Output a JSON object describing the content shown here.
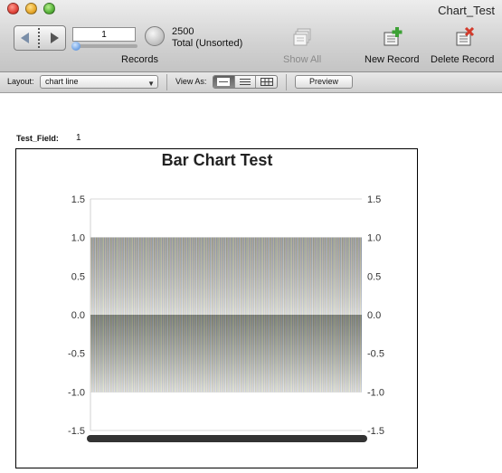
{
  "window": {
    "title": "Chart_Test"
  },
  "toolbar": {
    "record_input_value": "1",
    "record_count": "2500",
    "record_status": "Total (Unsorted)",
    "records_label": "Records",
    "show_all_label": "Show All",
    "new_record_label": "New Record",
    "delete_record_label": "Delete Record"
  },
  "layout_bar": {
    "layout_label": "Layout:",
    "layout_value": "chart line",
    "view_as_label": "View As:",
    "preview_label": "Preview"
  },
  "record": {
    "field_label": "Test_Field:",
    "field_value": "1"
  },
  "chart_data": {
    "type": "bar",
    "title": "Bar Chart Test",
    "ylim": [
      -1.5,
      1.5
    ],
    "yticks": [
      "1.5",
      "1.0",
      "0.5",
      "0.0",
      "-0.5",
      "-1.0",
      "-1.5"
    ],
    "ytick_values": [
      1.5,
      1.0,
      0.5,
      0.0,
      -0.5,
      -1.0,
      -1.5
    ],
    "series": [
      {
        "values": [
          1.0,
          -1.0
        ]
      }
    ],
    "grid": true,
    "legend": "none"
  }
}
